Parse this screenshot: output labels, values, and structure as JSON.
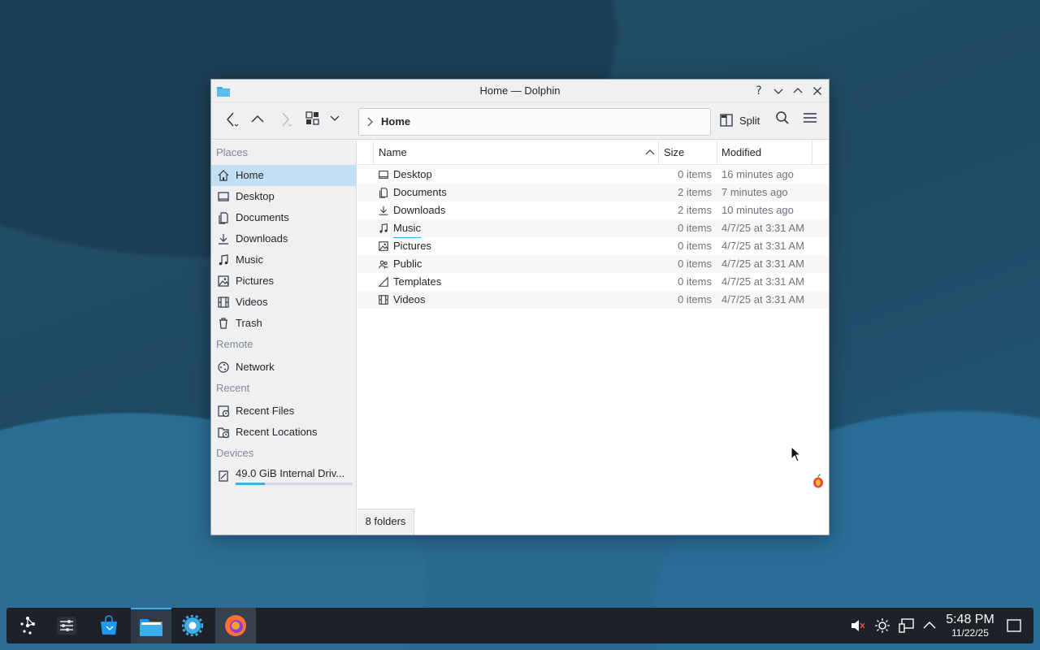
{
  "window": {
    "title": "Home — Dolphin",
    "controls": {
      "help": "?",
      "minimize": "⌄",
      "maximize": "⌃",
      "close": "✕"
    }
  },
  "toolbar": {
    "location": "Home",
    "split_label": "Split"
  },
  "sidebar": {
    "sections": [
      {
        "title": "Places",
        "items": [
          {
            "label": "Home",
            "icon": "home-icon",
            "selected": true
          },
          {
            "label": "Desktop",
            "icon": "desktop-icon"
          },
          {
            "label": "Documents",
            "icon": "documents-icon"
          },
          {
            "label": "Downloads",
            "icon": "downloads-icon"
          },
          {
            "label": "Music",
            "icon": "music-icon"
          },
          {
            "label": "Pictures",
            "icon": "pictures-icon"
          },
          {
            "label": "Videos",
            "icon": "videos-icon"
          },
          {
            "label": "Trash",
            "icon": "trash-icon"
          }
        ]
      },
      {
        "title": "Remote",
        "items": [
          {
            "label": "Network",
            "icon": "network-icon"
          }
        ]
      },
      {
        "title": "Recent",
        "items": [
          {
            "label": "Recent Files",
            "icon": "recent-files-icon"
          },
          {
            "label": "Recent Locations",
            "icon": "recent-locations-icon"
          }
        ]
      },
      {
        "title": "Devices",
        "items": [
          {
            "label": "49.0 GiB Internal Driv...",
            "icon": "drive-icon",
            "usage_fraction": 0.25
          }
        ]
      }
    ]
  },
  "file_view": {
    "columns": {
      "name": "Name",
      "size": "Size",
      "modified": "Modified"
    },
    "rows": [
      {
        "name": "Desktop",
        "size": "0 items",
        "modified": "16 minutes ago",
        "icon": "desktop-icon"
      },
      {
        "name": "Documents",
        "size": "2 items",
        "modified": "7 minutes ago",
        "icon": "documents-icon"
      },
      {
        "name": "Downloads",
        "size": "2 items",
        "modified": "10 minutes ago",
        "icon": "downloads-icon"
      },
      {
        "name": "Music",
        "size": "0 items",
        "modified": "4/7/25 at 3:31 AM",
        "icon": "music-icon"
      },
      {
        "name": "Pictures",
        "size": "0 items",
        "modified": "4/7/25 at 3:31 AM",
        "icon": "pictures-icon"
      },
      {
        "name": "Public",
        "size": "0 items",
        "modified": "4/7/25 at 3:31 AM",
        "icon": "public-icon"
      },
      {
        "name": "Templates",
        "size": "0 items",
        "modified": "4/7/25 at 3:31 AM",
        "icon": "templates-icon"
      },
      {
        "name": "Videos",
        "size": "0 items",
        "modified": "4/7/25 at 3:31 AM",
        "icon": "videos-icon"
      }
    ],
    "status": "8 folders"
  },
  "taskbar": {
    "clock_time": "5:48 PM",
    "clock_date": "11/22/25"
  },
  "colors": {
    "accent": "#3daee9",
    "selection": "#c2dff3",
    "panel": "#1c2228"
  }
}
